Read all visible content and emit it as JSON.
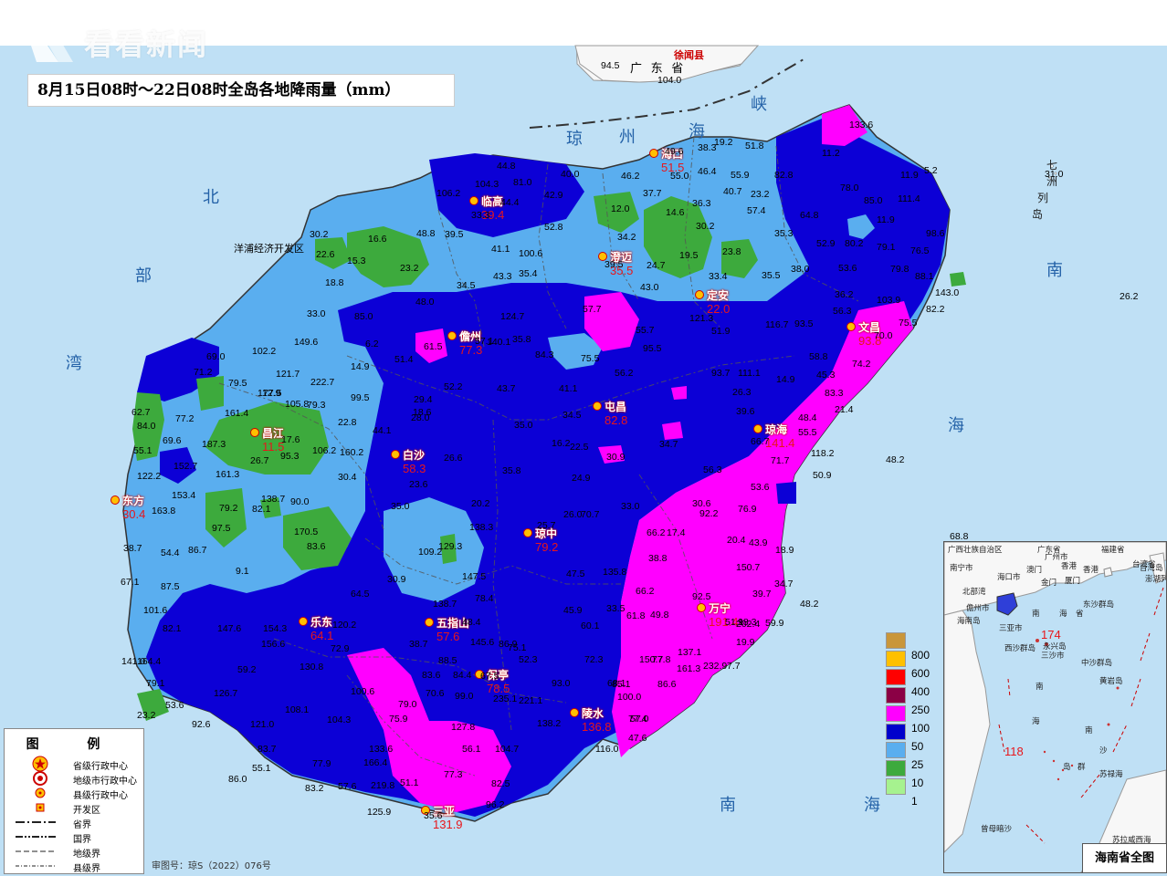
{
  "title": "8月15日08时～22日08时全岛各地降雨量（mm）",
  "watermark": "看看新闻",
  "approval_number": "审图号：琼S（2022）076号",
  "sea_labels": [
    {
      "text": "琼"
    },
    {
      "text": "州"
    },
    {
      "text": "海"
    },
    {
      "text": "峡"
    },
    {
      "text": "北"
    },
    {
      "text": "部"
    },
    {
      "text": "湾"
    },
    {
      "text": "南"
    },
    {
      "text": "海"
    },
    {
      "text": "南"
    },
    {
      "text": "海"
    },
    {
      "text": "七"
    },
    {
      "text": "洲"
    },
    {
      "text": "列"
    },
    {
      "text": "岛"
    }
  ],
  "mainland_labels": {
    "province": "广 东 省",
    "county": "徐闻县",
    "zone": "洋浦经济开发区"
  },
  "cities": [
    {
      "name": "海口",
      "value": "51.5"
    },
    {
      "name": "临高",
      "value": "39.4"
    },
    {
      "name": "澄迈",
      "value": "35.5"
    },
    {
      "name": "定安",
      "value": "22.0"
    },
    {
      "name": "文昌",
      "value": "93.8"
    },
    {
      "name": "儋州",
      "value": "77.3"
    },
    {
      "name": "屯昌",
      "value": "82.8"
    },
    {
      "name": "琼海",
      "value": "141.4"
    },
    {
      "name": "昌江",
      "value": "11.5"
    },
    {
      "name": "白沙",
      "value": "58.3"
    },
    {
      "name": "东方",
      "value": "30.4"
    },
    {
      "name": "琼中",
      "value": "79.2"
    },
    {
      "name": "万宁",
      "value": "191.4"
    },
    {
      "name": "乐东",
      "value": "64.1"
    },
    {
      "name": "五指山",
      "value": "57.6"
    },
    {
      "name": "保亭",
      "value": "78.5"
    },
    {
      "name": "陵水",
      "value": "136.8"
    },
    {
      "name": "三亚",
      "value": "131.9"
    }
  ],
  "station_values": [
    "94.5",
    "104.0",
    "49.6",
    "38.3",
    "19.2",
    "51.8",
    "133.6",
    "11.2",
    "44.8",
    "40.0",
    "46.2",
    "55.0",
    "46.4",
    "55.9",
    "82.8",
    "104.3",
    "81.0",
    "42.9",
    "37.7",
    "40.7",
    "23.2",
    "78.0",
    "11.9",
    "5.2",
    "31.0",
    "106.2",
    "44.4",
    "33.3",
    "12.0",
    "14.6",
    "36.3",
    "57.4",
    "85.0",
    "111.4",
    "48.8",
    "39.5",
    "52.8",
    "30.2",
    "64.8",
    "11.9",
    "30.2",
    "16.6",
    "41.1",
    "100.6",
    "34.2",
    "19.5",
    "23.8",
    "35.3",
    "52.9",
    "80.2",
    "79.1",
    "76.5",
    "98.6",
    "22.6",
    "15.3",
    "23.2",
    "39.5",
    "24.7",
    "33.4",
    "38.0",
    "53.6",
    "79.8",
    "88.1",
    "26.2",
    "18.8",
    "43.3",
    "35.4",
    "34.5",
    "43.0",
    "35.5",
    "36.2",
    "103.9",
    "143.0",
    "48.0",
    "33.0",
    "85.0",
    "57.7",
    "121.3",
    "51.9",
    "82.2",
    "124.7",
    "35.8",
    "55.7",
    "93.5",
    "56.3",
    "75.5",
    "149.6",
    "6.2",
    "61.5",
    "140.1",
    "84.3",
    "95.5",
    "116.7",
    "58.8",
    "70.0",
    "102.2",
    "121.7",
    "14.9",
    "51.4",
    "57.1",
    "75.5",
    "56.2",
    "93.7",
    "111.1",
    "74.2",
    "71.2",
    "79.5",
    "222.7",
    "52.2",
    "41.1",
    "14.9",
    "45.3",
    "69.0",
    "79.3",
    "99.5",
    "29.4",
    "43.7",
    "26.3",
    "83.3",
    "112.9",
    "77.5",
    "105.8",
    "18.6",
    "39.6",
    "21.4",
    "62.7",
    "77.2",
    "161.4",
    "22.8",
    "28.0",
    "35.0",
    "34.5",
    "48.4",
    "84.0",
    "69.6",
    "187.3",
    "17.6",
    "44.1",
    "26.6",
    "16.2",
    "34.7",
    "55.5",
    "55.1",
    "95.3",
    "160.2",
    "22.5",
    "35.8",
    "30.9",
    "56.3",
    "66.7",
    "71.7",
    "118.2",
    "122.2",
    "152.7",
    "161.3",
    "26.7",
    "106.2",
    "30.4",
    "23.6",
    "24.9",
    "50.9",
    "48.2",
    "153.4",
    "138.7",
    "90.0",
    "35.0",
    "30.6",
    "33.0",
    "53.6",
    "79.2",
    "82.1",
    "163.8",
    "20.2",
    "26.0",
    "70.7",
    "66.2",
    "92.2",
    "76.9",
    "97.5",
    "170.5",
    "109.2",
    "138.3",
    "17.4",
    "20.4",
    "38.7",
    "54.4",
    "86.7",
    "83.6",
    "129.3",
    "147.5",
    "25.7",
    "38.8",
    "43.9",
    "18.9",
    "9.1",
    "30.9",
    "47.5",
    "135.8",
    "150.7",
    "34.7",
    "67.1",
    "87.5",
    "64.5",
    "138.7",
    "78.4",
    "66.2",
    "39.7",
    "48.2",
    "101.6",
    "154.3",
    "48.4",
    "45.9",
    "33.5",
    "49.8",
    "92.5",
    "98.3",
    "82.1",
    "147.6",
    "120.2",
    "145.6",
    "86.9",
    "60.1",
    "61.8",
    "51.1",
    "59.9",
    "141.0",
    "164.4",
    "156.6",
    "38.7",
    "72.9",
    "75.1",
    "88.5",
    "52.3",
    "72.3",
    "77.8",
    "137.1",
    "202.4",
    "19.9",
    "79.1",
    "59.2",
    "130.8",
    "83.6",
    "84.4",
    "67.5",
    "93.0",
    "68.1",
    "150.7",
    "161.3",
    "232.9",
    "7.7",
    "23.2",
    "53.6",
    "126.7",
    "100.6",
    "79.0",
    "70.6",
    "99.0",
    "235.1",
    "221.1",
    "85.1",
    "100.0",
    "86.6",
    "92.6",
    "121.0",
    "108.1",
    "75.9",
    "127.8",
    "138.2",
    "57.0",
    "83.7",
    "104.3",
    "133.6",
    "56.1",
    "104.7",
    "77.4",
    "86.0",
    "55.1",
    "77.9",
    "166.4",
    "77.3",
    "82.5",
    "116.0",
    "47.6",
    "83.2",
    "57.6",
    "219.8",
    "51.1",
    "96.2",
    "125.9",
    "35.6",
    "68.8"
  ],
  "legend": {
    "title": "图 例",
    "items": [
      {
        "label": "省级行政中心",
        "icon": "star-in-circle-icon"
      },
      {
        "label": "地级市行政中心",
        "icon": "double-circle-icon"
      },
      {
        "label": "县级行政中心",
        "icon": "dot-circle-icon"
      },
      {
        "label": "开发区",
        "icon": "square-dot-icon"
      },
      {
        "label": "省界",
        "icon": "boundary-line-icon"
      },
      {
        "label": "国界",
        "icon": "boundary-line-icon"
      },
      {
        "label": "地级界",
        "icon": "boundary-line-icon"
      },
      {
        "label": "县级界",
        "icon": "boundary-line-icon"
      }
    ]
  },
  "color_scale": [
    {
      "label": "800",
      "color": "#c9963a"
    },
    {
      "label": "600",
      "color": "#ffc000"
    },
    {
      "label": "400",
      "color": "#ff0000"
    },
    {
      "label": "250",
      "color": "#8b0045"
    },
    {
      "label": "100",
      "color": "#ff00ff"
    },
    {
      "label": "50",
      "color": "#0000cc"
    },
    {
      "label": "25",
      "color": "#5aaeef"
    },
    {
      "label": "10",
      "color": "#3daa3d"
    },
    {
      "label": "1",
      "color": "#a6f28f"
    }
  ],
  "colors": {
    "sea": "#bfe0f5",
    "band_light": "#9ff39a",
    "band_green": "#3daa3d",
    "band_light_blue": "#5aaeef",
    "band_blue": "#0c00d6",
    "band_magenta": "#ff00ff",
    "land_outside": "#f7f7f7"
  },
  "inset": {
    "title": "海南省全图",
    "labels": [
      "广西壮族自治区",
      "广东省",
      "福建省",
      "台湾省",
      "南宁市",
      "广州市",
      "香港",
      "澳门",
      "海口市",
      "儋州市",
      "三亚市",
      "三沙市",
      "海南岛",
      "北部湾",
      "南",
      "海",
      "省",
      "东沙群岛",
      "西沙群岛",
      "永兴岛",
      "中沙群岛",
      "黄岩岛",
      "南",
      "海",
      "南",
      "沙",
      "群",
      "岛",
      "苏禄海",
      "曾母暗沙",
      "174",
      "118",
      "台湾岛",
      "澎湖列岛",
      "金门",
      "厦门",
      "香港",
      "苏拉威西海"
    ]
  }
}
